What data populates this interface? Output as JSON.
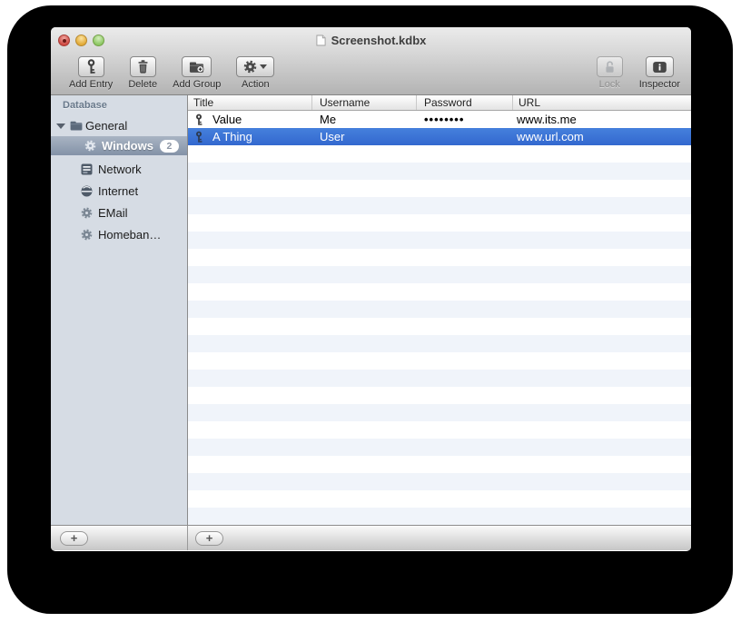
{
  "window": {
    "title": "Screenshot.kdbx"
  },
  "toolbar": {
    "buttons": [
      {
        "label": "Add Entry",
        "icon": "key-icon",
        "enabled": true
      },
      {
        "label": "Delete",
        "icon": "trash-icon",
        "enabled": true
      },
      {
        "label": "Add Group",
        "icon": "folder-plus-icon",
        "enabled": true
      },
      {
        "label": "Action",
        "icon": "gear-icon",
        "enabled": true,
        "has_dropdown": true
      },
      {
        "label": "Lock",
        "icon": "lock-open-icon",
        "enabled": false
      },
      {
        "label": "Inspector",
        "icon": "inspector-icon",
        "enabled": true
      }
    ]
  },
  "sidebar": {
    "header": "Database",
    "root_group": {
      "label": "General",
      "icon": "folder-icon",
      "expanded": true
    },
    "items": [
      {
        "label": "Windows",
        "icon": "gear-icon",
        "badge": "2",
        "selected": true
      },
      {
        "label": "Network",
        "icon": "network-icon",
        "selected": false
      },
      {
        "label": "Internet",
        "icon": "globe-icon",
        "selected": false
      },
      {
        "label": "EMail",
        "icon": "gear-icon",
        "selected": false
      },
      {
        "label": "Homeban…",
        "icon": "gear-icon",
        "selected": false
      }
    ],
    "add_button": "+"
  },
  "table": {
    "columns": [
      "Title",
      "Username",
      "Password",
      "URL"
    ],
    "entries": [
      {
        "title": "Value",
        "username": "Me",
        "password_masked": "••••••••",
        "url": "www.its.me",
        "selected": false
      },
      {
        "title": "A Thing",
        "username": "User",
        "password_masked": "",
        "url": "www.url.com",
        "selected": true
      }
    ],
    "add_button": "+"
  },
  "colors": {
    "selection_blue": "#3875d7",
    "row_stripe": "#f0f4fa",
    "sidebar_bg": "#d6dce4",
    "sidebar_selection": "#8392a7",
    "toolbar_gray": "#b3b3b3"
  }
}
